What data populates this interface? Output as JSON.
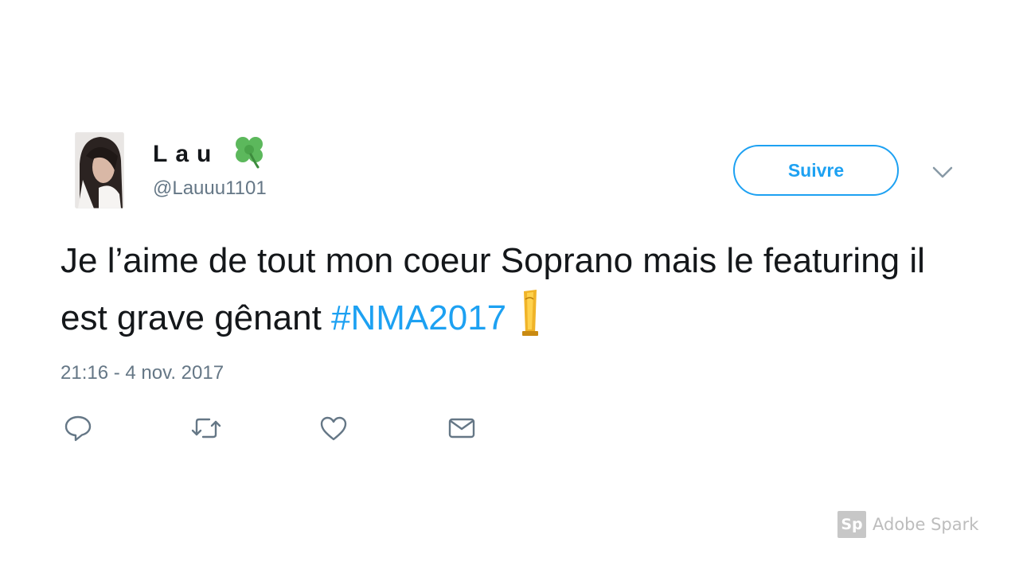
{
  "tweet": {
    "author": {
      "display_name": "Lau",
      "name_emoji": "four-leaf-clover-icon",
      "handle": "@Lauuu1101"
    },
    "follow_label": "Suivre",
    "text_main": "Je l’aime de tout mon coeur Soprano mais le featuring il est grave gênant ",
    "hashtag": "#NMA2017",
    "text_emoji": "trophy-icon",
    "timestamp": "21:16 - 4 nov. 2017",
    "actions": {
      "reply": "reply-icon",
      "retweet": "retweet-icon",
      "like": "like-icon",
      "dm": "direct-message-icon"
    }
  },
  "watermark": {
    "logo_text": "Sp",
    "label": "Adobe Spark"
  },
  "colors": {
    "accent": "#1da1f2",
    "text": "#14171a",
    "secondary": "#657786",
    "watermark": "#bdbdbd"
  }
}
